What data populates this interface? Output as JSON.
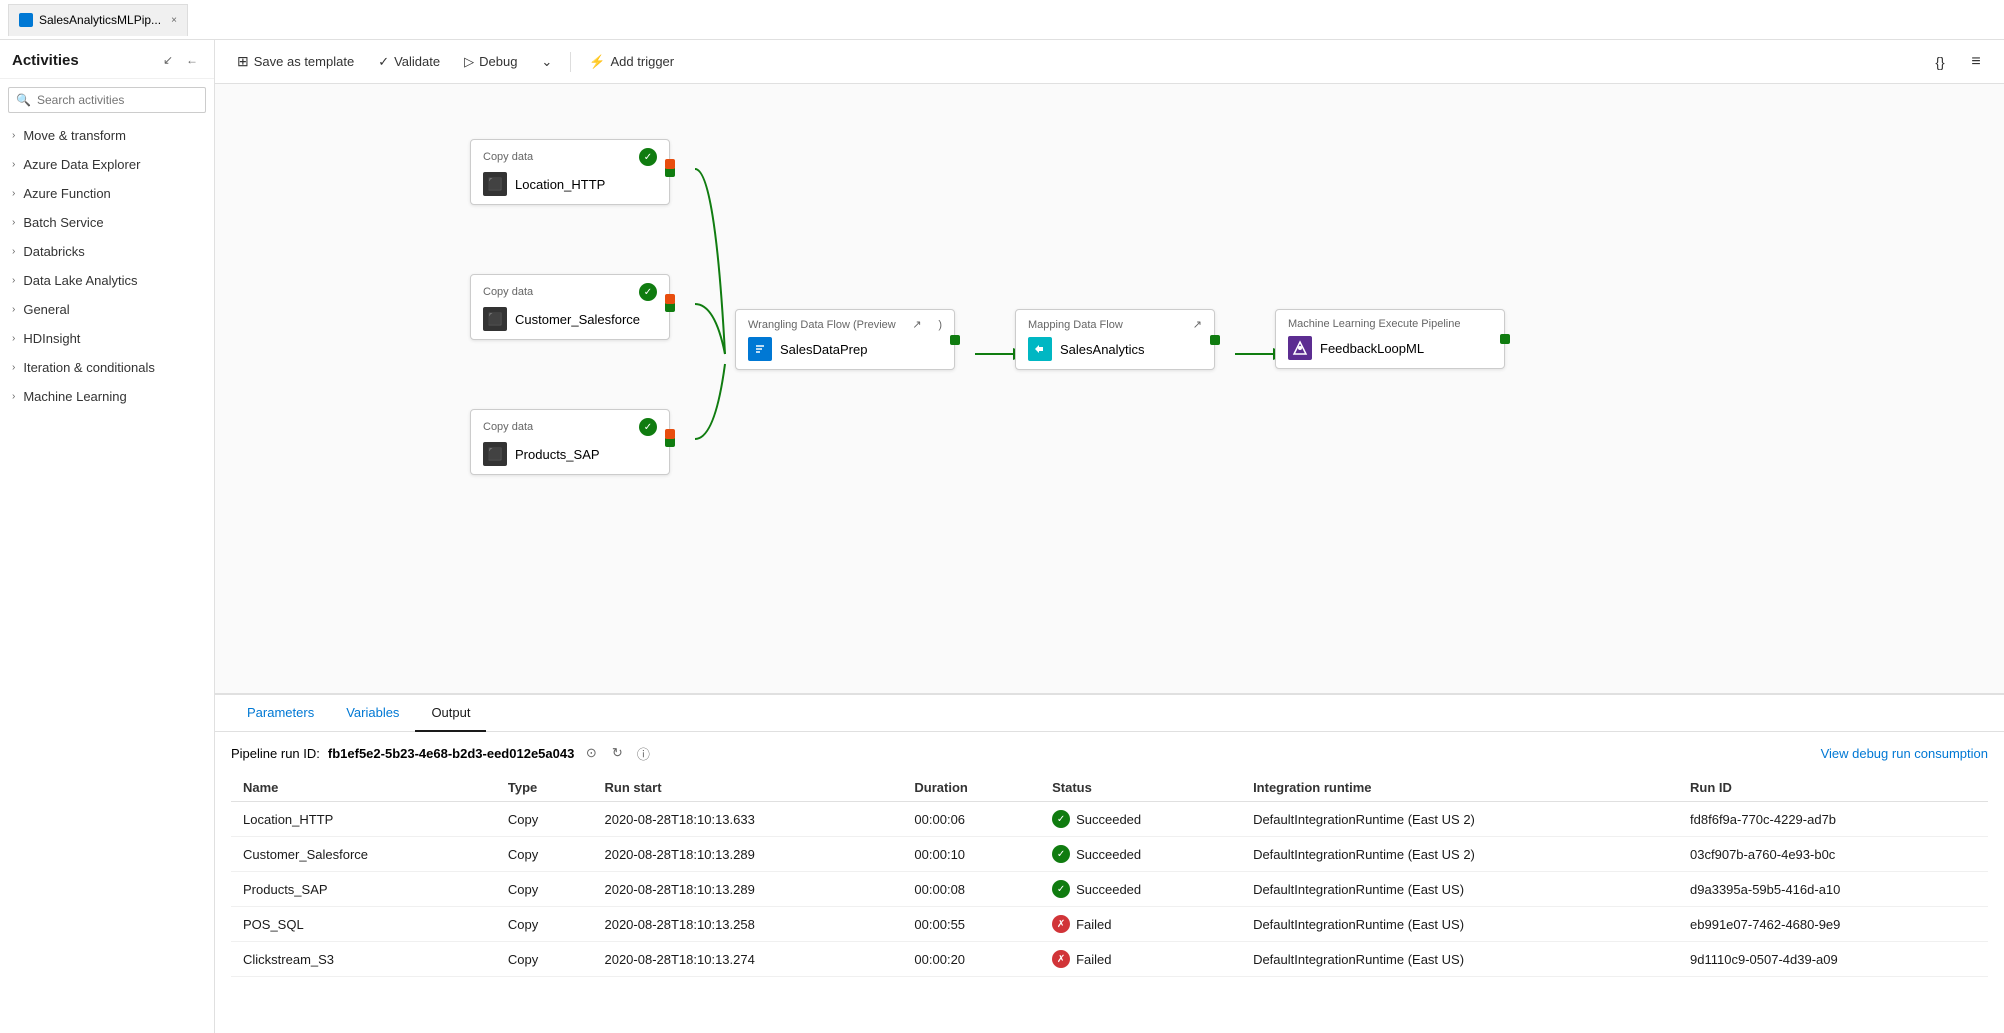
{
  "tab": {
    "title": "SalesAnalyticsMLPip...",
    "close_label": "×"
  },
  "sidebar": {
    "title": "Activities",
    "search_placeholder": "Search activities",
    "controls": [
      "↙",
      "←"
    ],
    "items": [
      {
        "label": "Move & transform"
      },
      {
        "label": "Azure Data Explorer"
      },
      {
        "label": "Azure Function"
      },
      {
        "label": "Batch Service"
      },
      {
        "label": "Databricks"
      },
      {
        "label": "Data Lake Analytics"
      },
      {
        "label": "General"
      },
      {
        "label": "HDInsight"
      },
      {
        "label": "Iteration & conditionals"
      },
      {
        "label": "Machine Learning"
      }
    ]
  },
  "toolbar": {
    "save_as_template": "Save as template",
    "validate": "Validate",
    "debug": "Debug",
    "add_trigger": "Add trigger",
    "code_icon": "{}",
    "settings_icon": "⚙"
  },
  "nodes": {
    "copy1": {
      "type": "Copy data",
      "name": "Location_HTTP"
    },
    "copy2": {
      "type": "Copy data",
      "name": "Customer_Salesforce"
    },
    "copy3": {
      "type": "Copy data",
      "name": "Products_SAP"
    },
    "wrangling": {
      "type": "Wrangling Data Flow (Preview)",
      "name": "SalesDataPrep",
      "external_icon": "↗"
    },
    "mapping": {
      "type": "Mapping Data Flow",
      "name": "SalesAnalytics",
      "external_icon": "↗"
    },
    "ml": {
      "type": "Machine Learning Execute Pipeline",
      "name": "FeedbackLoopML"
    }
  },
  "bottom_panel": {
    "tabs": [
      "Parameters",
      "Variables",
      "Output"
    ],
    "active_tab": "Output",
    "pipeline_run_label": "Pipeline run ID:",
    "pipeline_run_id": "fb1ef5e2-5b23-4e68-b2d3-eed012e5a043",
    "view_link": "View debug run consumption",
    "columns": [
      "Name",
      "Type",
      "Run start",
      "Duration",
      "Status",
      "Integration runtime",
      "Run ID"
    ],
    "rows": [
      {
        "name": "Location_HTTP",
        "type": "Copy",
        "run_start": "2020-08-28T18:10:13.633",
        "duration": "00:00:06",
        "status": "Succeeded",
        "status_type": "success",
        "runtime": "DefaultIntegrationRuntime (East US 2)",
        "run_id": "fd8f6f9a-770c-4229-ad7b"
      },
      {
        "name": "Customer_Salesforce",
        "type": "Copy",
        "run_start": "2020-08-28T18:10:13.289",
        "duration": "00:00:10",
        "status": "Succeeded",
        "status_type": "success",
        "runtime": "DefaultIntegrationRuntime (East US 2)",
        "run_id": "03cf907b-a760-4e93-b0c"
      },
      {
        "name": "Products_SAP",
        "type": "Copy",
        "run_start": "2020-08-28T18:10:13.289",
        "duration": "00:00:08",
        "status": "Succeeded",
        "status_type": "success",
        "runtime": "DefaultIntegrationRuntime (East US)",
        "run_id": "d9a3395a-59b5-416d-a10"
      },
      {
        "name": "POS_SQL",
        "type": "Copy",
        "run_start": "2020-08-28T18:10:13.258",
        "duration": "00:00:55",
        "status": "Failed",
        "status_type": "failed",
        "runtime": "DefaultIntegrationRuntime (East US)",
        "run_id": "eb991e07-7462-4680-9e9"
      },
      {
        "name": "Clickstream_S3",
        "type": "Copy",
        "run_start": "2020-08-28T18:10:13.274",
        "duration": "00:00:20",
        "status": "Failed",
        "status_type": "failed",
        "runtime": "DefaultIntegrationRuntime (East US)",
        "run_id": "9d1110c9-0507-4d39-a09"
      }
    ]
  }
}
